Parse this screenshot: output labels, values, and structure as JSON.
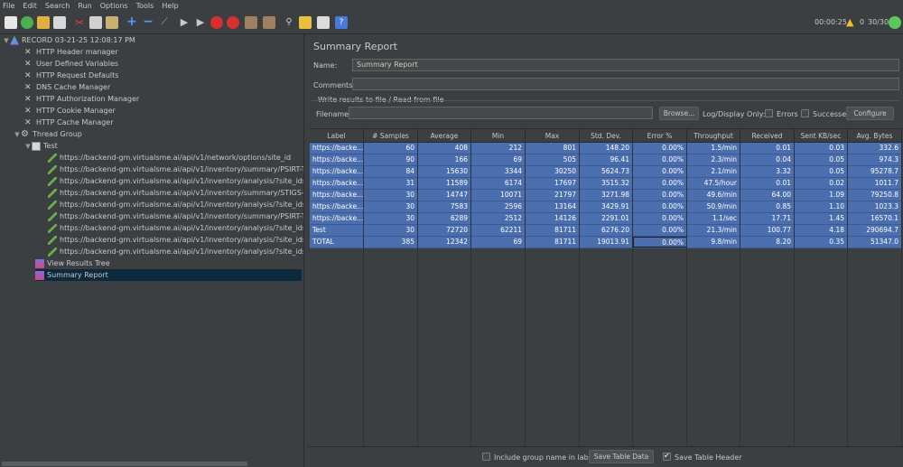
{
  "menu": [
    "File",
    "Edit",
    "Search",
    "Run",
    "Options",
    "Tools",
    "Help"
  ],
  "toolbar": {
    "icons": [
      "new-icon",
      "templates-icon",
      "open-icon",
      "save-icon",
      "cut-icon",
      "copy-icon",
      "paste-icon",
      "expand-icon",
      "collapse-icon",
      "toggle-icon",
      "start-icon",
      "start-no-pause-icon",
      "stop-icon",
      "shutdown-icon",
      "clear-icon",
      "clear-all-icon",
      "search-icon",
      "reset-search-icon",
      "function-helper-icon",
      "help-icon"
    ],
    "timer": "00:00:25",
    "warnings": "0",
    "threads": "30/30"
  },
  "tree": {
    "root": "RECORD 03-21-25 12:08:17 PM",
    "config": [
      "HTTP Header manager",
      "User Defined Variables",
      "HTTP Request Defaults",
      "DNS Cache Manager",
      "HTTP Authorization Manager",
      "HTTP Cookie Manager",
      "HTTP Cache Manager"
    ],
    "thread_group": "Thread Group",
    "controller": "Test",
    "samplers": [
      "https://backend-gm.virtualsme.ai/api/v1/network/options/site_id",
      "https://backend-gm.virtualsme.ai/api/v1/inventory/summary/PSIRT-T,STIGS-T",
      "https://backend-gm.virtualsme.ai/api/v1/inventory/analysis/?site_ids=PSIRT-T,",
      "https://backend-gm.virtualsme.ai/api/v1/inventory/summary/STIGS-T",
      "https://backend-gm.virtualsme.ai/api/v1/inventory/analysis/?site_ids=STIGS-T",
      "https://backend-gm.virtualsme.ai/api/v1/inventory/summary/PSIRT-T",
      "https://backend-gm.virtualsme.ai/api/v1/inventory/analysis/?site_ids=PSIRT-T",
      "https://backend-gm.virtualsme.ai/api/v1/inventory/analysis/?site_ids=PSIRT-T,STIGS-T",
      "https://backend-gm.virtualsme.ai/api/v1/inventory/analysis/?site_ids=PSIRT-T,S"
    ],
    "listeners": [
      "View Results Tree",
      "Summary Report"
    ]
  },
  "panel": {
    "title": "Summary Report",
    "name_label": "Name:",
    "name_value": "Summary Report",
    "comments_label": "Comments:",
    "write_label": "Write results to file / Read from file",
    "filename_label": "Filename",
    "browse": "Browse...",
    "log_display": "Log/Display Only:",
    "errors": "Errors",
    "successes": "Successes",
    "configure": "Configure"
  },
  "table": {
    "columns": [
      "Label",
      "# Samples",
      "Average",
      "Min",
      "Max",
      "Std. Dev.",
      "Error %",
      "Throughput",
      "Received KB/s...",
      "Sent KB/sec",
      "Avg. Bytes"
    ],
    "rows": [
      [
        "https://backe...",
        "60",
        "408",
        "212",
        "801",
        "148.20",
        "0.00%",
        "1.5/min",
        "0.01",
        "0.03",
        "332.6"
      ],
      [
        "https://backe...",
        "90",
        "166",
        "69",
        "505",
        "96.41",
        "0.00%",
        "2.3/min",
        "0.04",
        "0.05",
        "974.3"
      ],
      [
        "https://backe...",
        "84",
        "15630",
        "3344",
        "30250",
        "5624.73",
        "0.00%",
        "2.1/min",
        "3.32",
        "0.05",
        "95278.7"
      ],
      [
        "https://backe...",
        "31",
        "11589",
        "6174",
        "17697",
        "3515.32",
        "0.00%",
        "47.5/hour",
        "0.01",
        "0.02",
        "1011.7"
      ],
      [
        "https://backe...",
        "30",
        "14747",
        "10071",
        "21797",
        "3271.98",
        "0.00%",
        "49.6/min",
        "64.00",
        "1.09",
        "79250.8"
      ],
      [
        "https://backe...",
        "30",
        "7583",
        "2596",
        "13164",
        "3429.91",
        "0.00%",
        "50.9/min",
        "0.85",
        "1.10",
        "1023.3"
      ],
      [
        "https://backe...",
        "30",
        "6289",
        "2512",
        "14126",
        "2291.01",
        "0.00%",
        "1.1/sec",
        "17.71",
        "1.45",
        "16570.1"
      ],
      [
        "Test",
        "30",
        "72720",
        "62211",
        "81711",
        "6276.20",
        "0.00%",
        "21.3/min",
        "100.77",
        "4.18",
        "290694.7"
      ],
      [
        "TOTAL",
        "385",
        "12342",
        "69",
        "81711",
        "19013.91",
        "0.00%",
        "9.8/min",
        "8.20",
        "0.35",
        "51347.0"
      ]
    ]
  },
  "bottom": {
    "include_group": "Include group name in label?",
    "save_data": "Save Table Data",
    "save_header": "Save Table Header"
  }
}
